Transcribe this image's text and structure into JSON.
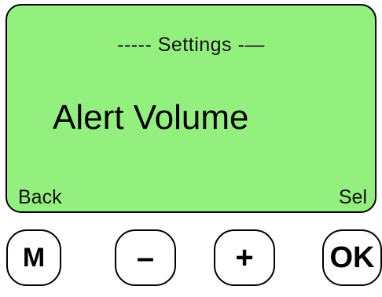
{
  "screen": {
    "header": "----- Settings -—",
    "item": "Alert Volume",
    "softkey_left": "Back",
    "softkey_right": "Sel",
    "background_color": "#94f07e"
  },
  "buttons": {
    "menu": "M",
    "minus": "–",
    "plus": "+",
    "ok": "OK"
  }
}
